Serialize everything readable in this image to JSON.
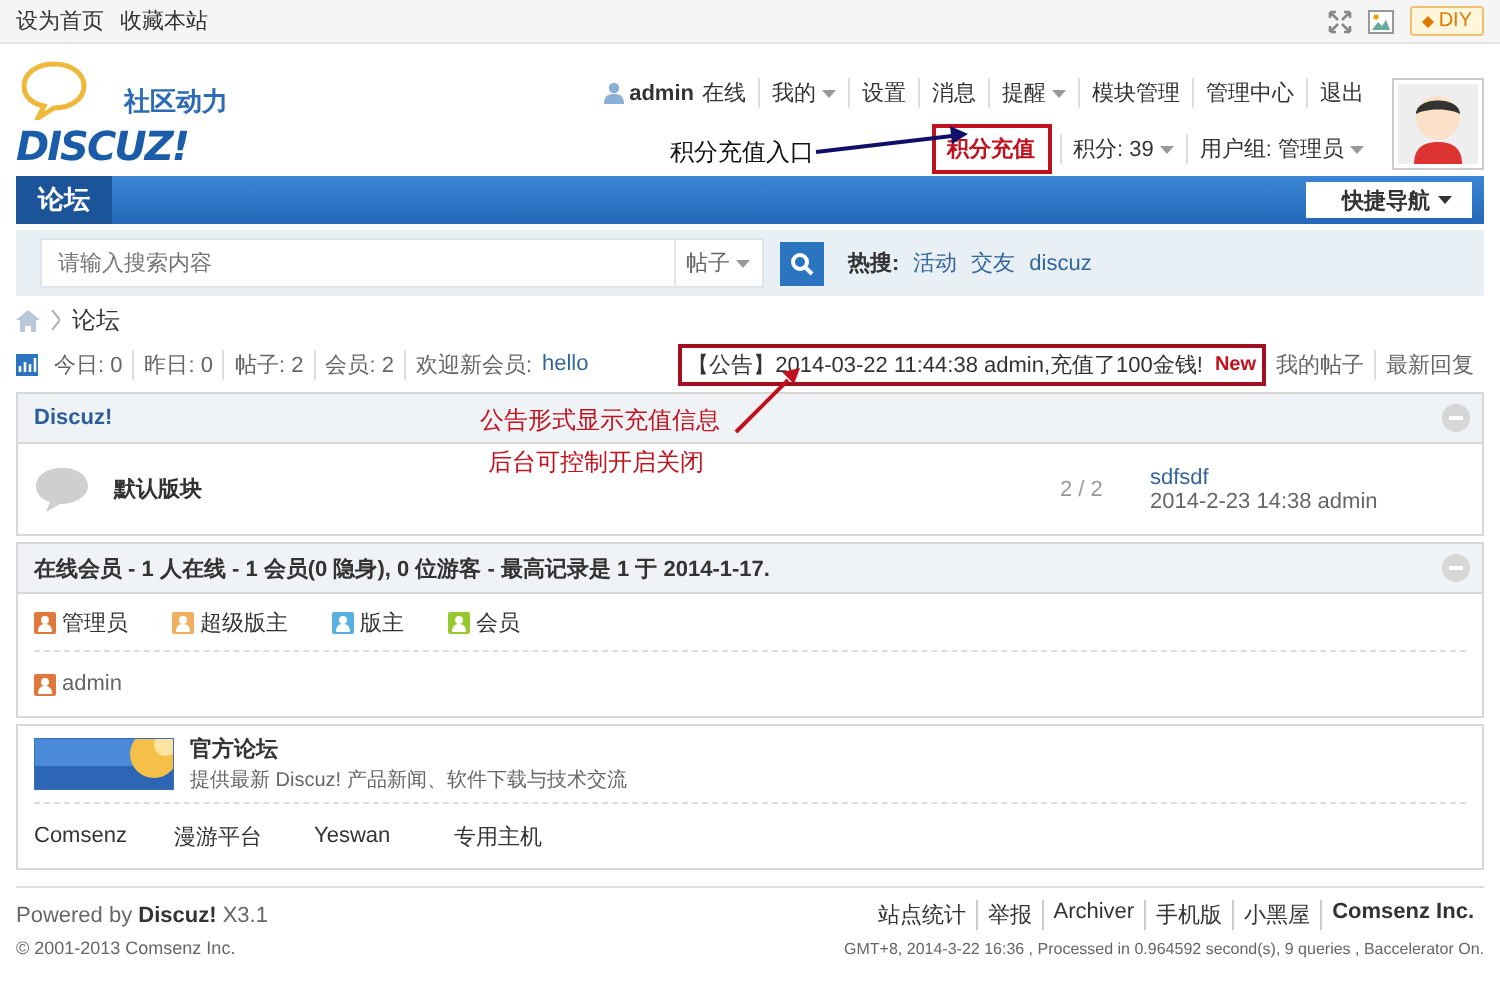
{
  "top_links": [
    "设为首页",
    "收藏本站"
  ],
  "diy_button": "DIY",
  "logo": {
    "tagline": "社区动力",
    "wordmark": "DISCUZ!"
  },
  "user_nav": {
    "username": "admin",
    "status": "在线",
    "links": [
      {
        "label": "我的",
        "dropdown": true
      },
      {
        "label": "设置",
        "dropdown": false
      },
      {
        "label": "消息",
        "dropdown": false
      },
      {
        "label": "提醒",
        "dropdown": true
      },
      {
        "label": "模块管理",
        "dropdown": false
      },
      {
        "label": "管理中心",
        "dropdown": false
      },
      {
        "label": "退出",
        "dropdown": false
      }
    ]
  },
  "account": {
    "recharge": "积分充值",
    "credits": "积分: 39",
    "group": "用户组: 管理员"
  },
  "nav": {
    "tabs": [
      {
        "label": "论坛",
        "selected": true
      }
    ],
    "quick_nav": "快捷导航"
  },
  "search": {
    "placeholder": "请输入搜索内容",
    "scope": "帖子",
    "hot_label": "热搜:",
    "hot": [
      "活动",
      "交友",
      "discuz"
    ]
  },
  "breadcrumb": [
    "论坛"
  ],
  "stats": [
    "今日: 0",
    "昨日: 0",
    "帖子: 2",
    "会员: 2"
  ],
  "new_member": {
    "label": "欢迎新会员:",
    "name": "hello"
  },
  "announcement": {
    "text": "【公告】2014-03-22 11:44:38 admin,充值了100金钱!",
    "badge": "New"
  },
  "quick_links": [
    "我的帖子",
    "最新回复"
  ],
  "category": {
    "title": "Discuz!",
    "forums": [
      {
        "name": "默认版块",
        "counts": "2 / 2",
        "last_title": "sdfsdf",
        "last_meta": "2014-2-23 14:38 admin"
      }
    ]
  },
  "online": {
    "title": "在线会员 - 1 人在线 - 1 会员(0 隐身), 0 位游客 - 最高记录是 1 于 2014-1-17.",
    "legend": [
      {
        "label": "管理员",
        "color": "#e0783c"
      },
      {
        "label": "超级版主",
        "color": "#f0b060"
      },
      {
        "label": "版主",
        "color": "#58b0e0"
      },
      {
        "label": "会员",
        "color": "#98c830"
      }
    ],
    "members": [
      {
        "name": "admin",
        "color": "#e0783c"
      }
    ]
  },
  "friend_links": {
    "featured": {
      "title": "官方论坛",
      "description": "提供最新 Discuz! 产品新闻、软件下载与技术交流"
    },
    "links": [
      "Comsenz",
      "漫游平台",
      "Yeswan",
      "专用主机"
    ]
  },
  "footer": {
    "powered": "Powered by **Discuz!** X3.1",
    "copyright": "© 2001-2013 Comsenz Inc.",
    "links": [
      "站点统计",
      "举报",
      "Archiver",
      "手机版",
      "小黑屋"
    ],
    "company": "Comsenz Inc.",
    "info": "GMT+8, 2014-3-22 16:36 , Processed in 0.964592 second(s), 9 queries , Baccelerator On."
  },
  "annotations": [
    {
      "text": "积分充值入口"
    },
    {
      "text": "公告形式显示充值信息"
    },
    {
      "text": "后台可控制开启关闭"
    }
  ]
}
